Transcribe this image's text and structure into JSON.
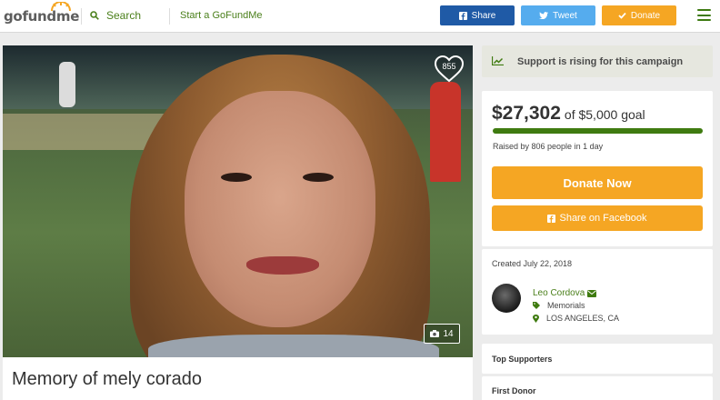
{
  "header": {
    "logo_go": "go",
    "logo_fund": "fund",
    "logo_me": "me",
    "search_label": "Search",
    "start_label": "Start a GoFundMe",
    "share_label": "Share",
    "tweet_label": "Tweet",
    "donate_label": "Donate"
  },
  "campaign": {
    "title": "Memory of mely corado",
    "hearts": "855",
    "photo_count": "14"
  },
  "trend": {
    "text": "Support is rising for this campaign"
  },
  "donation": {
    "raised": "$27,302",
    "goal_text": "of $5,000 goal",
    "progress_fraction": 1.0,
    "raised_by": "Raised by 806 people in 1 day",
    "donate_now_label": "Donate Now",
    "share_facebook_label": "Share on Facebook"
  },
  "organizer": {
    "created": "Created July 22, 2018",
    "name": "Leo Cordova",
    "category": "Memorials",
    "location": "LOS ANGELES, CA"
  },
  "sections": {
    "top_supporters": "Top Supporters",
    "first_donor": "First Donor"
  },
  "colors": {
    "brand_green": "#3f7b10",
    "donate_orange": "#f5a623",
    "facebook_blue": "#1f5aa6",
    "twitter_blue": "#55acee"
  },
  "icons": {
    "search": "search-icon",
    "facebook": "facebook-icon",
    "twitter": "twitter-icon",
    "donate": "checkmark-icon",
    "menu": "hamburger-menu-icon",
    "heart": "heart-icon",
    "camera": "camera-icon",
    "trend": "trending-up-icon",
    "mail": "envelope-icon",
    "tag": "tag-icon",
    "location": "map-pin-icon"
  }
}
